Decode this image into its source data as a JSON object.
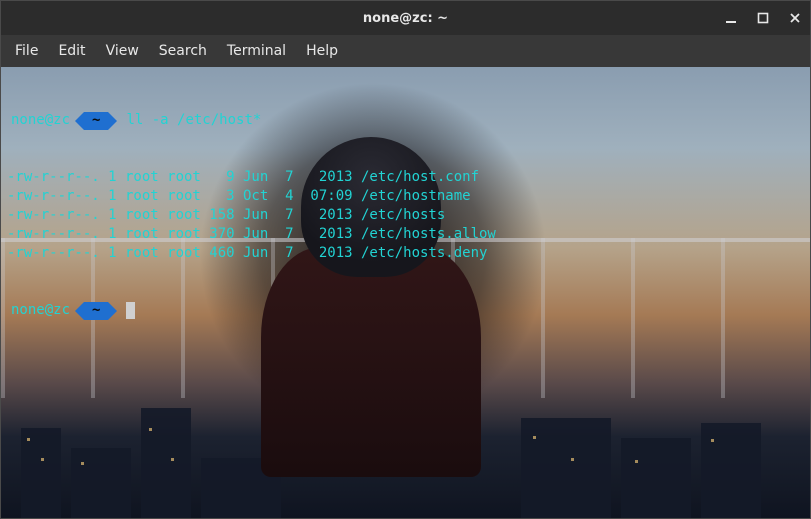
{
  "window": {
    "title": "none@zc: ~"
  },
  "menu": {
    "file": "File",
    "edit": "Edit",
    "view": "View",
    "search": "Search",
    "terminal": "Terminal",
    "help": "Help"
  },
  "prompt": {
    "user_host": "none@zc",
    "dir": "~"
  },
  "command": "ll -a /etc/host*",
  "listing": [
    {
      "perm": "-rw-r--r--.",
      "links": "1",
      "owner": "root",
      "group": "root",
      "size": "  9",
      "month": "Jun",
      "day": " 7",
      "time_or_year": " 2013",
      "path": "/etc/host.conf"
    },
    {
      "perm": "-rw-r--r--.",
      "links": "1",
      "owner": "root",
      "group": "root",
      "size": "  3",
      "month": "Oct",
      "day": " 4",
      "time_or_year": "07:09",
      "path": "/etc/hostname"
    },
    {
      "perm": "-rw-r--r--.",
      "links": "1",
      "owner": "root",
      "group": "root",
      "size": "158",
      "month": "Jun",
      "day": " 7",
      "time_or_year": " 2013",
      "path": "/etc/hosts"
    },
    {
      "perm": "-rw-r--r--.",
      "links": "1",
      "owner": "root",
      "group": "root",
      "size": "370",
      "month": "Jun",
      "day": " 7",
      "time_or_year": " 2013",
      "path": "/etc/hosts.allow"
    },
    {
      "perm": "-rw-r--r--.",
      "links": "1",
      "owner": "root",
      "group": "root",
      "size": "460",
      "month": "Jun",
      "day": " 7",
      "time_or_year": " 2013",
      "path": "/etc/hosts.deny"
    }
  ]
}
